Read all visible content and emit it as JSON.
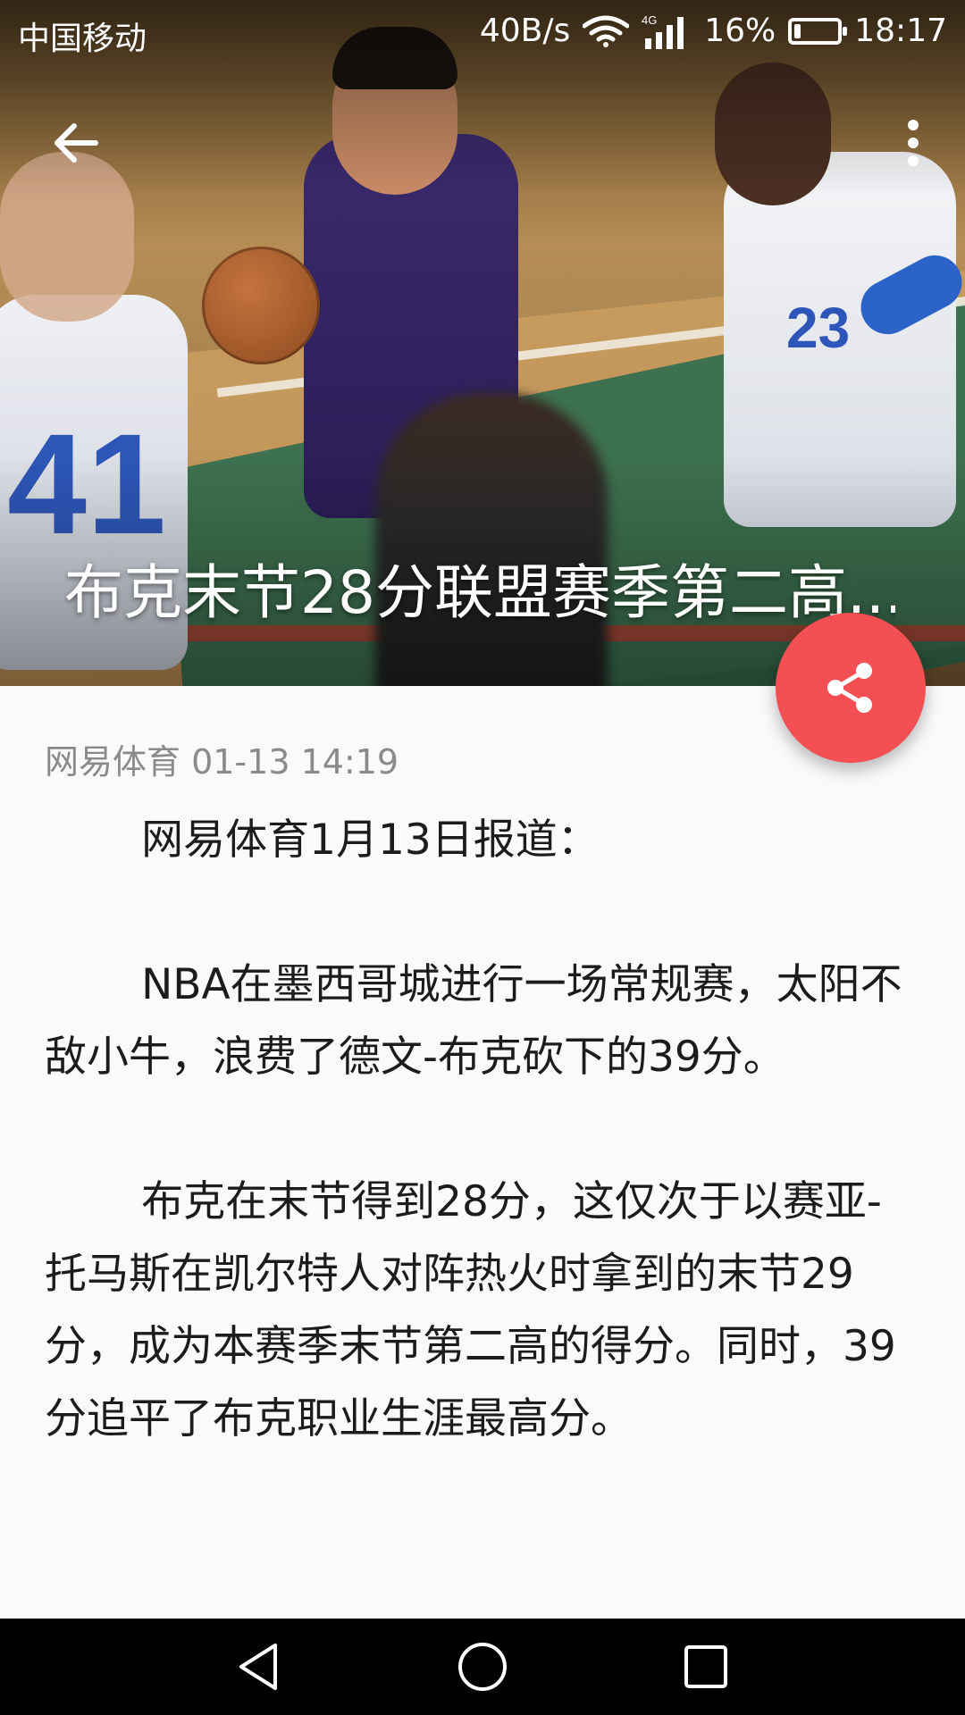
{
  "status_bar": {
    "carrier": "中国移动",
    "network_speed": "40B/s",
    "network_type": "4G",
    "battery": "16%",
    "battery_level": 0.16,
    "time": "18:17"
  },
  "toolbar": {
    "back_icon": "arrow-back-icon",
    "more_icon": "more-vert-icon"
  },
  "hero": {
    "title": "布克末节28分联盟赛季第二高...",
    "jersey_numbers": [
      "41",
      "23"
    ]
  },
  "fab": {
    "icon": "share-icon",
    "color": "#f44f52"
  },
  "meta": {
    "source_time": "网易体育 01-13 14:19"
  },
  "article": {
    "paragraphs": [
      "网易体育1月13日报道：",
      "NBA在墨西哥城进行一场常规赛，太阳不敌小牛，浪费了德文-布克砍下的39分。",
      "布克在末节得到28分，这仅次于以赛亚-托马斯在凯尔特人对阵热火时拿到的末节29分，成为本赛季末节第二高的得分。同时，39分追平了布克职业生涯最高分。"
    ]
  },
  "nav_bar": {
    "back_icon": "nav-back-icon",
    "home_icon": "nav-home-icon",
    "recents_icon": "nav-recents-icon"
  }
}
